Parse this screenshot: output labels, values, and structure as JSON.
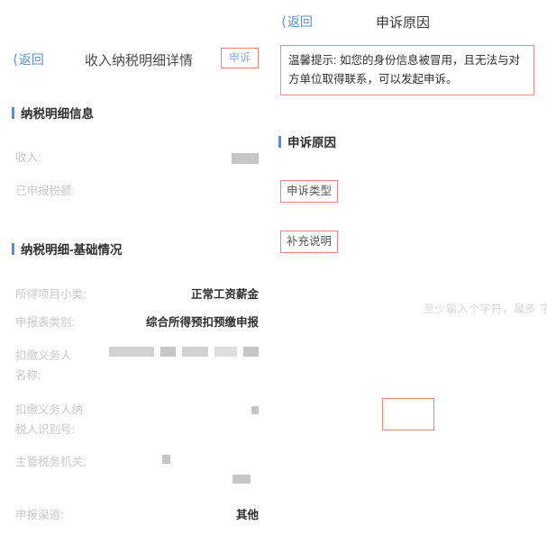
{
  "left_panel": {
    "back_label": "返回",
    "back_icon": "chevron-left-icon",
    "title": "收入纳税明细详情",
    "appeal_button": "申诉",
    "section_1": "纳税明细信息",
    "section_2": "纳税明细-基础情况",
    "rows_summary": [
      {
        "label": "收入:",
        "value": "",
        "redacted": true
      },
      {
        "label": "已申报税额:",
        "value": "",
        "redacted": false
      }
    ],
    "rows_basic": [
      {
        "label": "所得项目小类:",
        "value": "正常工资薪金"
      },
      {
        "label": "申报表类别:",
        "value": "综合所得预扣预缴申报"
      },
      {
        "label": "扣缴义务人名称:",
        "value": "",
        "redacted": true
      },
      {
        "label": "扣缴义务人纳税人识别号:",
        "value": "",
        "redacted": true
      },
      {
        "label": "主管税务机关:",
        "value": "",
        "redacted": true
      },
      {
        "label": "申报渠道:",
        "value": "其他"
      }
    ]
  },
  "right_panel": {
    "back_label": "返回",
    "back_icon": "chevron-left-icon",
    "title": "申诉原因",
    "notice": "温馨提示: 如您的身份信息被冒用，且无法与对方单位取得联系，可以发起申诉。",
    "section_title": "申诉原因",
    "appeal_type_label": "申诉类型",
    "supplement_label": "补充说明",
    "ghost_placeholder": "至少输入个字符，最多 字",
    "empty_box_label": ""
  },
  "colors": {
    "accent_blue": "#4a90e2",
    "link_blue": "#5b8fd9",
    "highlight_red": "#f08080",
    "text_dark": "#2e2e2e",
    "text_muted": "#c9c9c9"
  }
}
